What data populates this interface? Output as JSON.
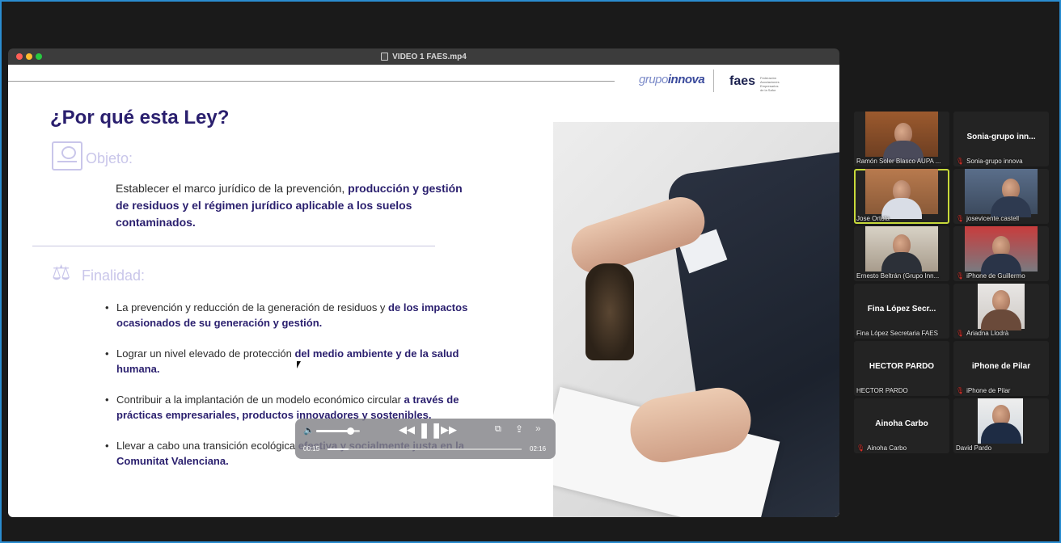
{
  "window": {
    "title": "VIDEO 1 FAES.mp4"
  },
  "slide": {
    "logo_grupo_light": "grupo",
    "logo_grupo_bold": "innova",
    "logo_faes": "faes",
    "logo_faes_sub": "Federación Asociaciones Empresarios de la Safor",
    "title": "¿Por qué esta Ley?",
    "objeto_label": "Objeto:",
    "objeto_text_1": "Establecer el marco jurídico de la prevención,",
    "objeto_text_2": "producción y gestión de residuos y el régimen jurídico aplicable a los suelos contaminados.",
    "finalidad_label": "Finalidad:",
    "bullets": [
      {
        "normal": "La prevención y reducción de la generación de residuos y ",
        "bold": "de los impactos ocasionados de su generación y gestión."
      },
      {
        "normal": "Lograr un nivel elevado de protección ",
        "bold": "del medio ambiente y de la salud humana."
      },
      {
        "normal": "Contribuir a la implantación de un modelo económico circular ",
        "bold": "a través de prácticas empresariales, productos innovadores y sostenibles."
      },
      {
        "normal": "Llevar a cabo una transición ecológica ",
        "bold": "efectiva y socialmente justa en la Comunitat Valenciana."
      }
    ]
  },
  "player": {
    "time_current": "00:15",
    "time_total": "02:16",
    "progress": 0.11,
    "volume": 0.78,
    "icons": {
      "volume": "volume-icon",
      "rewind": "rewind-icon",
      "pause": "pause-icon",
      "forward": "fast-forward-icon",
      "pip": "picture-in-picture-icon",
      "share": "share-icon",
      "more": "more-icon"
    }
  },
  "participants": [
    {
      "id": "ramon",
      "label": "Ramón Soler Blasco AUPA ...",
      "video": true,
      "muted": false,
      "active": false
    },
    {
      "id": "sonia",
      "label": "Sonia-grupo innova",
      "display": "Sonia-grupo inn...",
      "video": false,
      "muted": true,
      "active": false
    },
    {
      "id": "jose",
      "label": "Jose Ortola",
      "video": true,
      "muted": false,
      "active": true
    },
    {
      "id": "josevicente",
      "label": "josevicente.castell",
      "video": true,
      "muted": true,
      "active": false
    },
    {
      "id": "ernesto",
      "label": "Ernesto Beltrán (Grupo Inn...",
      "video": true,
      "muted": false,
      "active": false
    },
    {
      "id": "guillermo",
      "label": "iPhone de Guillermo",
      "video": true,
      "muted": true,
      "active": false
    },
    {
      "id": "fina",
      "label": "Fina López Secretaria FAES",
      "display": "Fina López Secr...",
      "video": false,
      "muted": false,
      "active": false
    },
    {
      "id": "ariadna",
      "label": "Ariadna Llodrà",
      "video": true,
      "muted": true,
      "active": false
    },
    {
      "id": "hector",
      "label": "HECTOR PARDO",
      "display": "HECTOR PARDO",
      "video": false,
      "muted": false,
      "active": false
    },
    {
      "id": "pilar",
      "label": "iPhone de Pilar",
      "display": "iPhone de Pilar",
      "video": false,
      "muted": true,
      "active": false
    },
    {
      "id": "ainoha",
      "label": "Ainoha Carbo",
      "display": "Ainoha Carbo",
      "video": false,
      "muted": true,
      "active": false
    },
    {
      "id": "david",
      "label": "David Pardo",
      "video": true,
      "muted": false,
      "active": false
    }
  ]
}
